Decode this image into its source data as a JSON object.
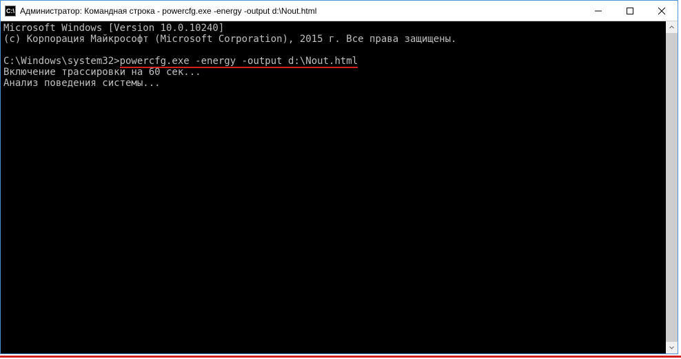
{
  "window": {
    "title": "Администратор: Командная строка - powercfg.exe  -energy -output d:\\Nout.html",
    "icon_label": "C:\\"
  },
  "terminal": {
    "line1": "Microsoft Windows [Version 10.0.10240]",
    "line2": "(c) Корпорация Майкрософт (Microsoft Corporation), 2015 г. Все права защищены.",
    "prompt": "C:\\Windows\\system32>",
    "command": "powercfg.exe -energy -output d:\\Nout.html",
    "line4": "Включение трассировки на 60 сек...",
    "line5": "Анализ поведения системы..."
  }
}
